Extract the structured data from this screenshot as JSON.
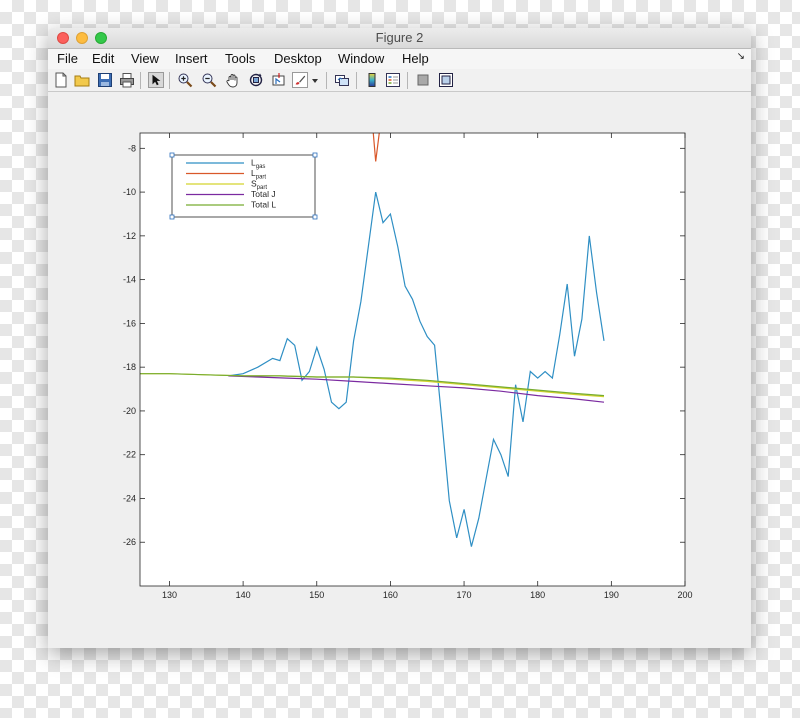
{
  "window": {
    "title": "Figure 2",
    "menu": [
      "File",
      "Edit",
      "View",
      "Insert",
      "Tools",
      "Desktop",
      "Window",
      "Help"
    ]
  },
  "toolbar": {
    "icons": [
      "new-figure-icon",
      "open-file-icon",
      "save-icon",
      "print-icon",
      "edit-plot-arrow-icon",
      "zoom-in-icon",
      "zoom-out-icon",
      "pan-hand-icon",
      "rotate-3d-icon",
      "data-cursor-icon",
      "brush-icon",
      "brush-dropdown-icon",
      "link-plot-icon",
      "insert-colorbar-icon",
      "insert-legend-icon",
      "hide-plot-tools-icon",
      "show-plot-tools-icon"
    ]
  },
  "colors": {
    "l_gas": "#2f8fc4",
    "l_part": "#d9582a",
    "s_part": "#d4d42e",
    "total_j": "#7b2aa0",
    "total_l": "#77ac30"
  },
  "chart_data": {
    "type": "line",
    "title": "",
    "xlabel": "",
    "ylabel": "",
    "xlim": [
      126,
      200
    ],
    "ylim": [
      -28,
      -7.3
    ],
    "xticks": [
      130,
      140,
      150,
      160,
      170,
      180,
      190,
      200
    ],
    "yticks": [
      -8,
      -10,
      -12,
      -14,
      -16,
      -18,
      -20,
      -22,
      -24,
      -26
    ],
    "grid": false,
    "legend": "top-left",
    "series": [
      {
        "name": "L",
        "sub": "gas",
        "color": "#2f8fc4",
        "x": [
          138,
          140,
          142,
          144,
          145,
          146,
          147,
          148,
          149,
          150,
          151,
          152,
          153,
          154,
          155,
          156,
          157,
          158,
          159,
          160,
          161,
          162,
          163,
          164,
          165,
          166,
          167,
          168,
          169,
          170,
          171,
          172,
          173,
          174,
          175,
          176,
          177,
          178,
          179,
          180,
          181,
          182,
          183,
          184,
          185,
          186,
          187,
          188,
          189
        ],
        "y": [
          -18.4,
          -18.3,
          -18.0,
          -17.6,
          -17.7,
          -16.7,
          -17.0,
          -18.6,
          -18.2,
          -17.1,
          -18.1,
          -19.6,
          -19.9,
          -19.6,
          -16.8,
          -15.0,
          -12.5,
          -10.0,
          -11.4,
          -11.0,
          -12.5,
          -14.3,
          -14.9,
          -15.9,
          -16.6,
          -17.0,
          -20.5,
          -24.1,
          -25.8,
          -24.5,
          -26.2,
          -24.9,
          -23.1,
          -21.3,
          -22.0,
          -23.0,
          -18.8,
          -20.5,
          -18.2,
          -18.5,
          -18.2,
          -18.5,
          -16.5,
          -14.2,
          -17.5,
          -15.8,
          -12.0,
          -14.6,
          -16.8
        ]
      },
      {
        "name": "L",
        "sub": "part",
        "color": "#d9582a",
        "x": [
          157.6,
          158.0,
          158.6
        ],
        "y": [
          -7.0,
          -8.6,
          -7.0
        ]
      },
      {
        "name": "S",
        "sub": "part",
        "color": "#d4d42e",
        "x": [
          126,
          130,
          135,
          140,
          145,
          150,
          155,
          160,
          165,
          170,
          175,
          180,
          185,
          189
        ],
        "y": [
          -18.3,
          -18.3,
          -18.35,
          -18.4,
          -18.4,
          -18.45,
          -18.45,
          -18.55,
          -18.65,
          -18.8,
          -18.95,
          -19.1,
          -19.25,
          -19.35
        ]
      },
      {
        "name": "Total J",
        "sub": "",
        "color": "#7b2aa0",
        "x": [
          138,
          142,
          146,
          150,
          155,
          160,
          165,
          170,
          175,
          180,
          185,
          189
        ],
        "y": [
          -18.4,
          -18.45,
          -18.5,
          -18.55,
          -18.65,
          -18.75,
          -18.85,
          -18.95,
          -19.1,
          -19.3,
          -19.45,
          -19.6
        ]
      },
      {
        "name": "Total L",
        "sub": "",
        "color": "#77ac30",
        "x": [
          126,
          130,
          135,
          140,
          145,
          150,
          155,
          160,
          165,
          170,
          175,
          180,
          185,
          189
        ],
        "y": [
          -18.3,
          -18.3,
          -18.35,
          -18.4,
          -18.4,
          -18.45,
          -18.45,
          -18.5,
          -18.6,
          -18.75,
          -18.9,
          -19.05,
          -19.2,
          -19.3
        ]
      }
    ]
  }
}
